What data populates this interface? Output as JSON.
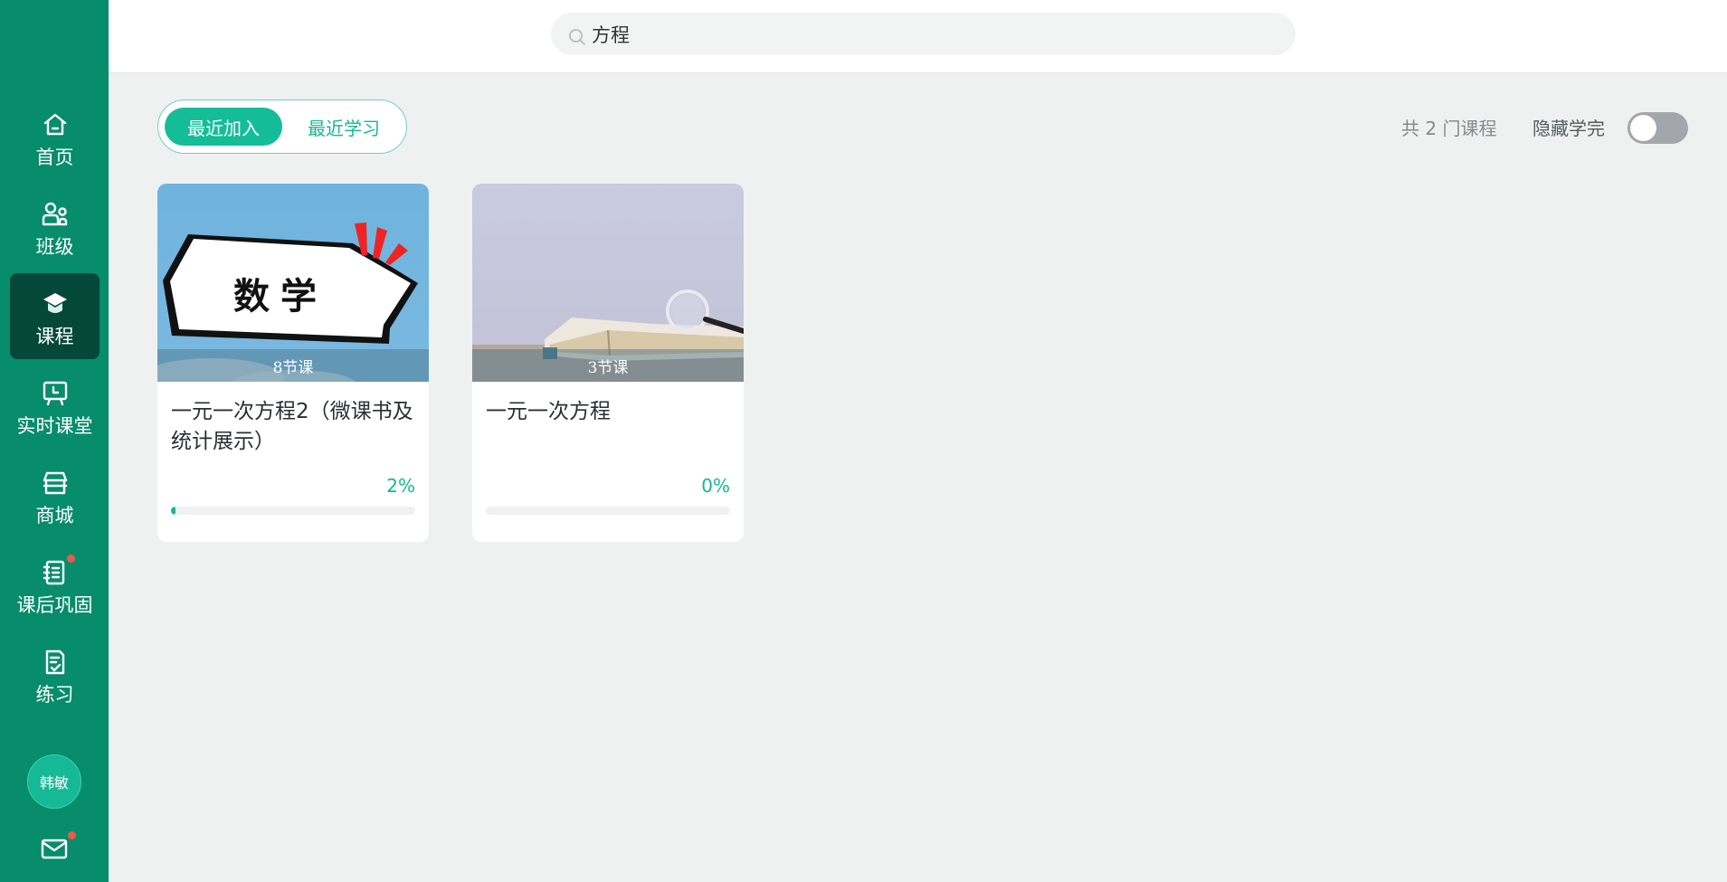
{
  "sidebar": {
    "items": [
      {
        "label": "首页",
        "icon": "home-icon"
      },
      {
        "label": "班级",
        "icon": "people-icon"
      },
      {
        "label": "课程",
        "icon": "graduation-cap-icon",
        "active": true
      },
      {
        "label": "实时课堂",
        "icon": "presentation-board-icon"
      },
      {
        "label": "商城",
        "icon": "store-icon"
      },
      {
        "label": "课后巩固",
        "icon": "notebook-icon",
        "badge": "red-dot"
      },
      {
        "label": "练习",
        "icon": "checklist-icon"
      }
    ],
    "avatar_text": "韩敏",
    "mail_icon": "mail-icon",
    "mail_badge": "red-dot"
  },
  "header": {
    "search": {
      "value": "方程",
      "icon": "search-icon"
    }
  },
  "toolbar": {
    "tabs": [
      {
        "label": "最近加入",
        "active": true
      },
      {
        "label": "最近学习",
        "active": false
      }
    ],
    "course_count": "共 2 门课程",
    "hide_completed_label": "隐藏学完",
    "hide_completed_on": false
  },
  "courses": [
    {
      "title": "一元一次方程2（微课书及统计展示）",
      "lessons": "8节课",
      "cover_text": "数学",
      "progress_label": "2%",
      "progress": 0.02
    },
    {
      "title": "一元一次方程",
      "lessons": "3节课",
      "progress_label": "0%",
      "progress": 0
    }
  ],
  "colors": {
    "sidebar": "#078c6c",
    "sidebar_active": "#04483a",
    "accent": "#14b892",
    "badge": "#f1584b"
  }
}
